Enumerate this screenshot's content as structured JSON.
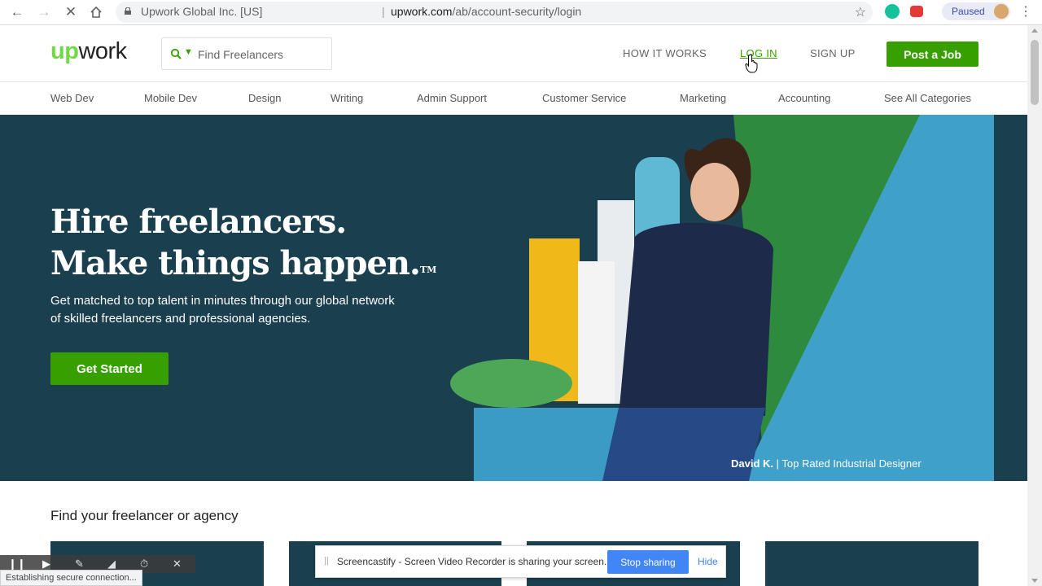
{
  "browser": {
    "origin_label": "Upwork Global Inc. [US]",
    "url_host": "upwork.com",
    "url_path": "/ab/account-security/login",
    "profile_status": "Paused",
    "status_text": "Establishing secure connection..."
  },
  "header": {
    "logo_up": "up",
    "logo_work": "work",
    "search_placeholder": "Find Freelancers",
    "nav": {
      "how_it_works": "HOW IT WORKS",
      "log_in": "LOG IN",
      "sign_up": "SIGN UP"
    },
    "post_job": "Post a Job"
  },
  "categories": [
    "Web Dev",
    "Mobile Dev",
    "Design",
    "Writing",
    "Admin Support",
    "Customer Service",
    "Marketing",
    "Accounting",
    "See All Categories"
  ],
  "hero": {
    "headline_line1": "Hire freelancers.",
    "headline_line2": "Make things happen.",
    "trademark": "TM",
    "subtext": "Get matched to top talent in minutes through our global network of skilled freelancers and professional agencies.",
    "cta": "Get Started",
    "caption_name": "David K.",
    "caption_sep": "|",
    "caption_title": "Top Rated Industrial Designer"
  },
  "section": {
    "find_title": "Find your freelancer or agency"
  },
  "share_bar": {
    "message": "Screencastify - Screen Video Recorder is sharing your screen.",
    "stop_label": "Stop sharing",
    "hide_label": "Hide"
  },
  "colors": {
    "brand_green": "#37a000",
    "logo_green": "#6fda44",
    "hero_bg": "#1a3f4e",
    "chrome_blue": "#4285f4"
  }
}
